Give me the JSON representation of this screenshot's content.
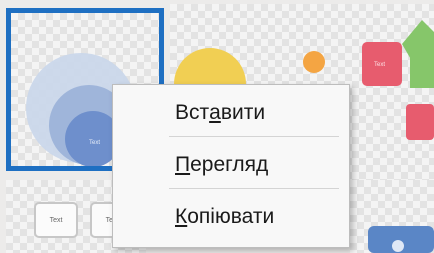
{
  "slides": {
    "card_text": "Text"
  },
  "context_menu": {
    "items": [
      {
        "pre": "Вст",
        "key": "а",
        "post": "вити"
      },
      {
        "pre": "",
        "key": "П",
        "post": "ерегляд"
      },
      {
        "pre": "",
        "key": "К",
        "post": "опіювати"
      }
    ]
  },
  "colors": {
    "selection_border": "#1e6fc2",
    "circle_outer": "#c9d6ea",
    "circle_mid": "#9fb5da",
    "circle_inner": "#6e8fcc",
    "yellow": "#f1cf53",
    "orange": "#f4a543",
    "pink": "#e75c6e",
    "green": "#86c66a",
    "blue": "#5a86c6"
  }
}
